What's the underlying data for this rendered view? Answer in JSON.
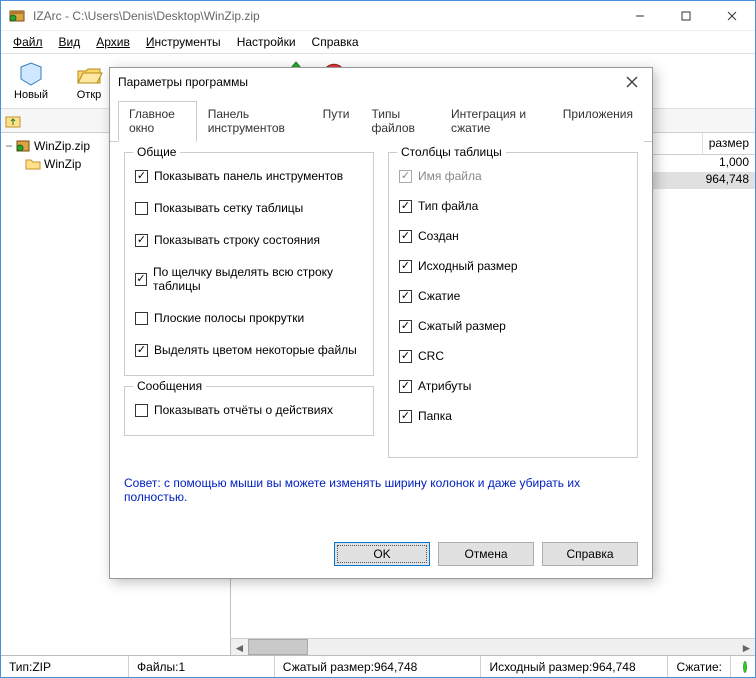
{
  "window": {
    "title": "IZArc - C:\\Users\\Denis\\Desktop\\WinZip.zip"
  },
  "menu": {
    "file": "Файл",
    "view": "Вид",
    "archive": "Архив",
    "tools_pre": "И",
    "tools_post": "нструменты",
    "settings": "Настройки",
    "help": "Справка"
  },
  "toolbar": {
    "new": "Новый",
    "open": "Откр"
  },
  "tree": {
    "root": "WinZip.zip",
    "child": "WinZip"
  },
  "columns": {
    "packed_size": "размер"
  },
  "rows": {
    "r1": "1,000",
    "r2": "964,748"
  },
  "status": {
    "type_label": "Тип: ",
    "type_value": "ZIP",
    "files_label": "Файлы: ",
    "files_value": "1",
    "packed_label": "Сжатый размер: ",
    "packed_value": "964,748",
    "orig_label": "Исходный размер: ",
    "orig_value": "964,748",
    "comp_label": "Сжатие:"
  },
  "dialog": {
    "title": "Параметры программы",
    "tabs": {
      "main": "Главное окно",
      "toolbar": "Панель инструментов",
      "paths": "Пути",
      "filetypes": "Типы файлов",
      "integration": "Интеграция и сжатие",
      "addons": "Приложения"
    },
    "groups": {
      "general": "Общие",
      "messages": "Сообщения",
      "columns": "Столбцы таблицы"
    },
    "general": {
      "show_toolbar": "Показывать панель инструментов",
      "show_grid": "Показывать сетку таблицы",
      "show_status": "Показывать строку состояния",
      "click_row": "По щелчку выделять всю строку таблицы",
      "flat_scroll": "Плоские полосы прокрутки",
      "highlight_files": "Выделять цветом некоторые файлы"
    },
    "messages": {
      "show_reports": "Показывать отчёты о действиях"
    },
    "columns": {
      "filename": "Имя файла",
      "filetype": "Тип файла",
      "created": "Создан",
      "orig_size": "Исходный размер",
      "compression": "Сжатие",
      "packed_size": "Сжатый размер",
      "crc": "CRC",
      "attributes": "Атрибуты",
      "folder": "Папка"
    },
    "hint": "Совет: с помощью мыши вы можете изменять ширину колонок и даже убирать их полностью.",
    "buttons": {
      "ok": "OK",
      "cancel": "Отмена",
      "help": "Справка"
    }
  }
}
